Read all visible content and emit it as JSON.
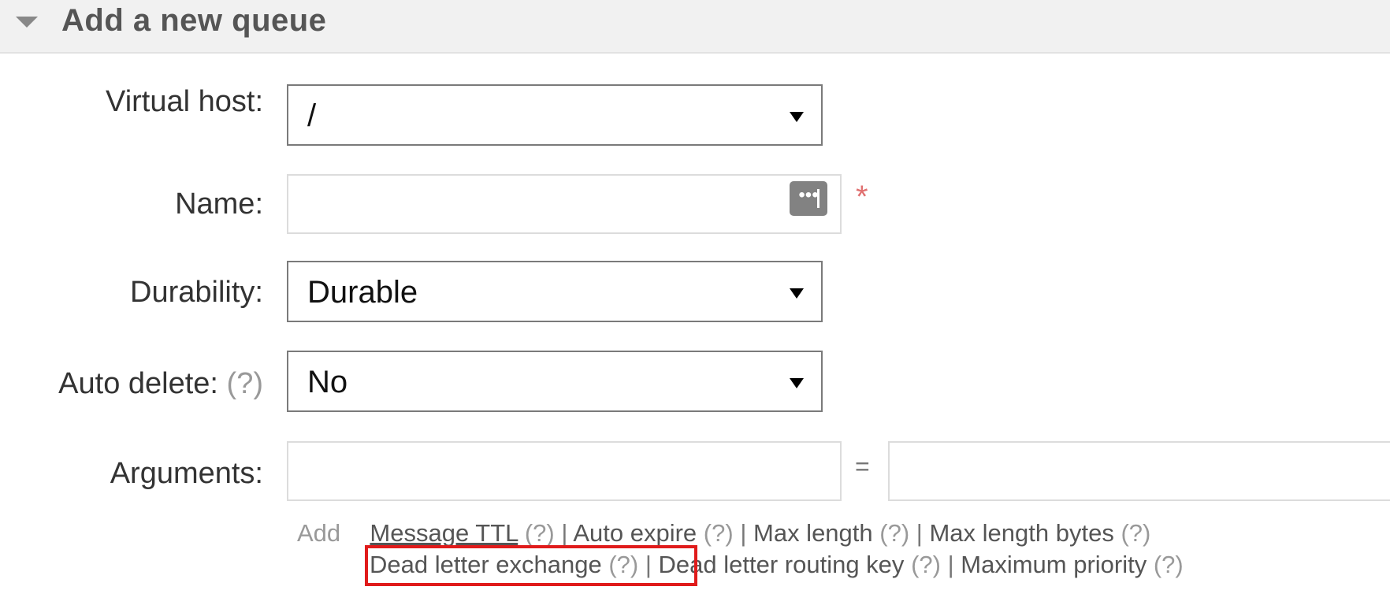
{
  "section": {
    "title": "Add a new queue",
    "icon": "triangle-down-icon"
  },
  "form": {
    "virtual_host": {
      "label": "Virtual host:",
      "value": "/"
    },
    "name": {
      "label": "Name:",
      "value": "",
      "required_marker": "*"
    },
    "durability": {
      "label": "Durability:",
      "value": "Durable"
    },
    "auto_delete": {
      "label": "Auto delete:",
      "help": "(?)",
      "value": "No"
    },
    "arguments": {
      "label": "Arguments:",
      "key_value": "",
      "equals": "=",
      "value_value": "",
      "add_label": "Add",
      "shortcuts_line1": [
        {
          "label": "Message TTL",
          "help": "(?)"
        },
        {
          "label": "Auto expire",
          "help": "(?)"
        },
        {
          "label": "Max length",
          "help": "(?)"
        },
        {
          "label": "Max length bytes",
          "help": "(?)"
        }
      ],
      "shortcuts_line2": [
        {
          "label": "Dead letter exchange",
          "help": "(?)"
        },
        {
          "label": "Dead letter routing key",
          "help": "(?)"
        },
        {
          "label": "Maximum priority",
          "help": "(?)"
        }
      ],
      "separator": "|"
    }
  },
  "colors": {
    "highlight_box": "#e01b1b",
    "required": "#e07070",
    "header_bg": "#f1f1f1"
  }
}
